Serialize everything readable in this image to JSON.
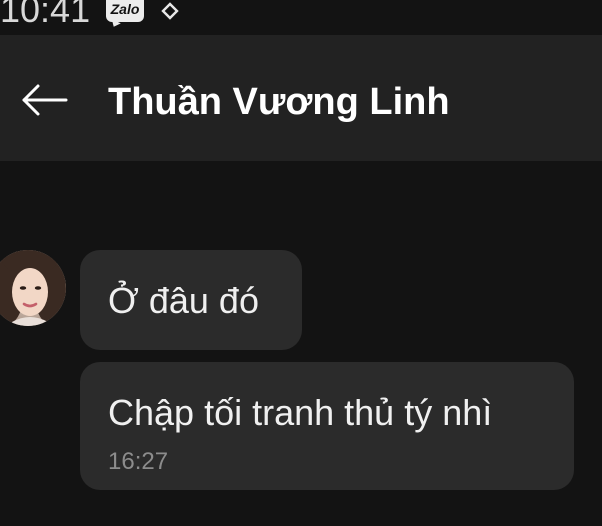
{
  "status_bar": {
    "time": "10:41",
    "zalo_icon_label": "Zalo",
    "icons": [
      "zalo-icon",
      "nav-sync-icon"
    ]
  },
  "header": {
    "back_icon": "arrow-left-icon",
    "contact_name": "Thuần Vương Linh"
  },
  "messages": [
    {
      "text": "Ở đâu đó"
    },
    {
      "text": "Chập tối tranh thủ tý nhì",
      "time": "16:27"
    }
  ],
  "colors": {
    "background": "#131313",
    "header": "#222222",
    "bubble": "#2b2b2b",
    "text": "#f0f0f0",
    "timestamp": "#8c8c8c"
  }
}
